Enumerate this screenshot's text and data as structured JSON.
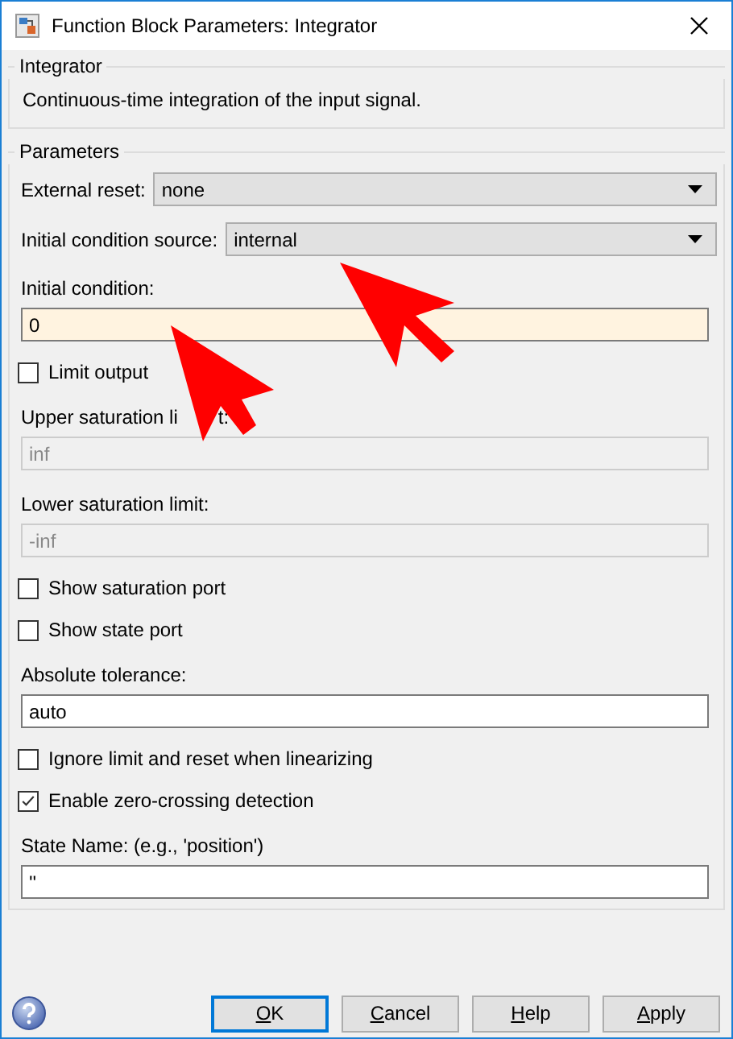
{
  "window": {
    "title": "Function Block Parameters: Integrator"
  },
  "description_group": {
    "title": "Integrator",
    "text": "Continuous-time integration of the input signal."
  },
  "parameters": {
    "title": "Parameters",
    "items": [
      {
        "kind": "dropdown",
        "label": "External reset:",
        "value": "none"
      },
      {
        "kind": "dropdown",
        "label": "Initial condition source:",
        "value": "internal"
      },
      {
        "kind": "field",
        "label": "Initial condition:",
        "value": "0",
        "disabled": false,
        "highlighted": true
      },
      {
        "kind": "checkbox",
        "label": "Limit output",
        "checked": false
      },
      {
        "kind": "field",
        "label": "Upper saturation li",
        "label_tail": "t:",
        "value": "inf",
        "disabled": true,
        "highlighted": false
      },
      {
        "kind": "field",
        "label": "Lower saturation limit:",
        "value": "-inf",
        "disabled": true,
        "highlighted": false
      },
      {
        "kind": "checkbox",
        "label": "Show saturation port",
        "checked": false
      },
      {
        "kind": "checkbox",
        "label": "Show state port",
        "checked": false
      },
      {
        "kind": "field",
        "label": "Absolute tolerance:",
        "value": "auto",
        "disabled": false,
        "highlighted": false
      },
      {
        "kind": "checkbox",
        "label": "Ignore limit and reset when linearizing",
        "checked": false
      },
      {
        "kind": "checkbox",
        "label": "Enable zero-crossing detection",
        "checked": true
      },
      {
        "kind": "field",
        "label": "State Name: (e.g., 'position')",
        "value": "''",
        "disabled": false,
        "highlighted": false
      }
    ]
  },
  "buttons": [
    {
      "access_key": "O",
      "rest": "K",
      "default": true
    },
    {
      "access_key": "C",
      "rest": "ancel",
      "default": false
    },
    {
      "access_key": "H",
      "rest": "elp",
      "default": false
    },
    {
      "access_key": "A",
      "rest": "pply",
      "default": false
    }
  ]
}
